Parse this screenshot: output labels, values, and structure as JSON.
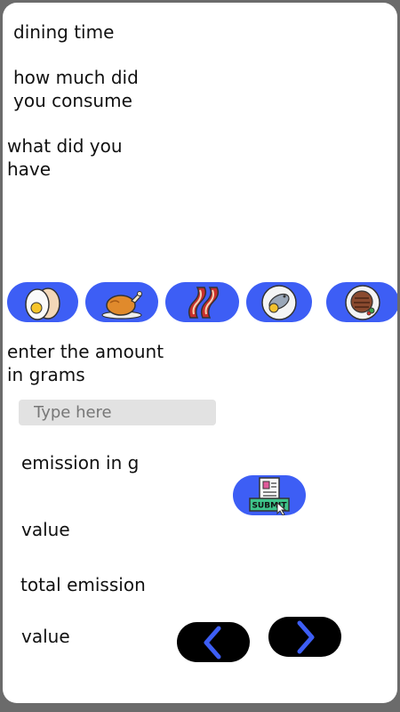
{
  "screen": {
    "title": "dining time",
    "consume_question": "how much did\nyou consume",
    "what_question": "what did you\nhave",
    "amount_prompt": "enter the amount\nin grams",
    "amount_placeholder": "Type here",
    "emission_label": "emission in g",
    "emission_value": "value",
    "total_label": "total emission",
    "total_value": "value",
    "submit_text": "SUBMIT"
  },
  "food_options": [
    {
      "name": "eggs",
      "icon": "eggs-icon"
    },
    {
      "name": "chicken",
      "icon": "roast-chicken-icon"
    },
    {
      "name": "bacon",
      "icon": "bacon-icon"
    },
    {
      "name": "fish",
      "icon": "fish-plate-icon"
    },
    {
      "name": "steak",
      "icon": "steak-plate-icon"
    }
  ],
  "colors": {
    "accent_blue": "#3d5ef5",
    "nav_black": "#000000",
    "arrow_blue": "#3d5ef5",
    "frame_gray": "#6b6b6b"
  }
}
